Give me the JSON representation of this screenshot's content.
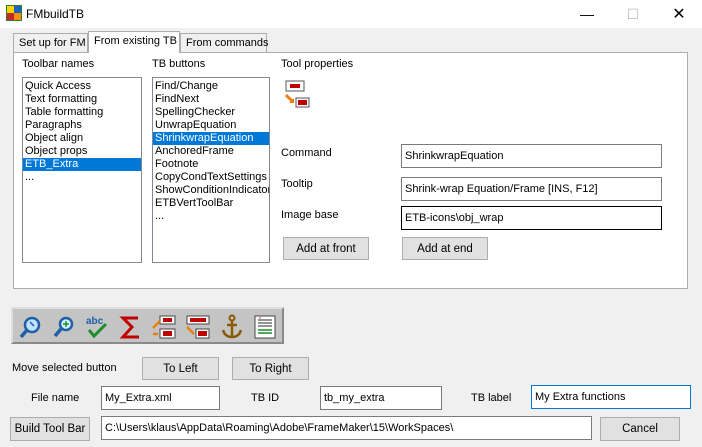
{
  "window": {
    "title": "FMbuildTB",
    "minimize_glyph": "—",
    "maximize_glyph": "☐",
    "close_glyph": "✕"
  },
  "tabs": [
    {
      "label": "Set up for FM",
      "active": false
    },
    {
      "label": "From existing TB",
      "active": true
    },
    {
      "label": "From commands",
      "active": false
    }
  ],
  "toolbar_names": {
    "label": "Toolbar names",
    "items": [
      "Quick Access",
      "Text formatting",
      "Table formatting",
      "Paragraphs",
      "Object align",
      "Object props",
      "ETB_Extra",
      "..."
    ],
    "selected_index": 6
  },
  "tb_buttons": {
    "label": "TB buttons",
    "items": [
      "Find/Change",
      "FindNext",
      "SpellingChecker",
      "UnwrapEquation",
      "ShrinkwrapEquation",
      "AnchoredFrame",
      "Footnote",
      "CopyCondTextSettings",
      "ShowConditionIndicator",
      "ETBVertToolBar",
      "..."
    ],
    "selected_index": 4
  },
  "tool_properties": {
    "label": "Tool properties",
    "preview_icon": "shrinkwrap-frame-icon",
    "command_label": "Command",
    "command_value": "ShrinkwrapEquation",
    "tooltip_label": "Tooltip",
    "tooltip_value": "Shrink-wrap Equation/Frame [INS, F12]",
    "image_base_label": "Image base",
    "image_base_value": "ETB-icons\\obj_wrap",
    "add_front_label": "Add at front",
    "add_end_label": "Add at end"
  },
  "preview_toolbar": {
    "icons": [
      "find-zoom-icon",
      "find-next-icon",
      "spellcheck-icon",
      "sigma-icon",
      "unwrap-icon",
      "shrinkwrap-icon",
      "anchor-icon",
      "footnote-icon"
    ]
  },
  "move": {
    "label": "Move selected button",
    "left_label": "To Left",
    "right_label": "To Right"
  },
  "bottom": {
    "file_name_label": "File name",
    "file_name_value": "My_Extra.xml",
    "tb_id_label": "TB ID",
    "tb_id_value": "tb_my_extra",
    "tb_label_label": "TB label",
    "tb_label_value": "My Extra functions",
    "build_label": "Build Tool Bar",
    "path_value": "C:\\Users\\klaus\\AppData\\Roaming\\Adobe\\FrameMaker\\15\\WorkSpaces\\",
    "cancel_label": "Cancel"
  },
  "colors": {
    "selection": "#0078d7",
    "frame_red": "#c00000",
    "arrow_orange": "#e87f0a",
    "icon_blue": "#1f5fa8",
    "icon_green": "#1a8f2a"
  }
}
